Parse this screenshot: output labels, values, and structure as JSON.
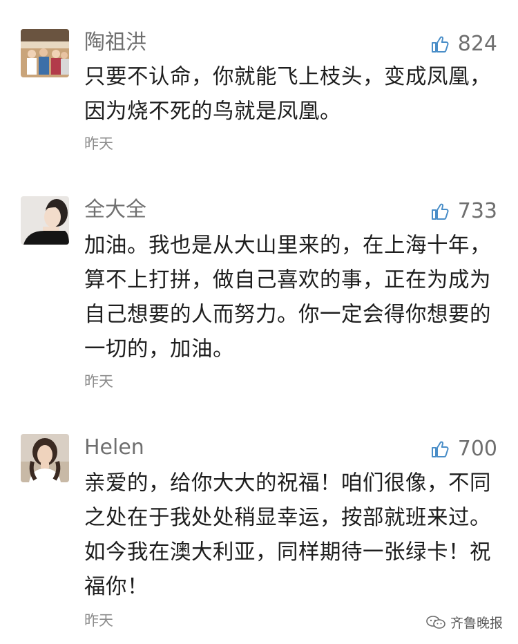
{
  "comments": [
    {
      "username": "陶祖洪",
      "likes": "824",
      "text": "只要不认命，你就能飞上枝头，变成凤凰，因为烧不死的鸟就是凤凰。",
      "time": "昨天",
      "avatar_icon": "avatar-group-photo"
    },
    {
      "username": "全大全",
      "likes": "733",
      "text": "加油。我也是从大山里来的，在上海十年，算不上打拼，做自己喜欢的事，正在为成为自己想要的人而努力。你一定会得你想要的一切的，加油。",
      "time": "昨天",
      "avatar_icon": "avatar-woman-portrait"
    },
    {
      "username": "Helen",
      "likes": "700",
      "text": "亲爱的，给你大大的祝福！咱们很像，不同之处在于我处处稍显幸运，按部就班来过。如今我在澳大利亚，同样期待一张绿卡！祝福你！",
      "time": "昨天",
      "avatar_icon": "avatar-woman-beach"
    }
  ],
  "watermark": {
    "text": "齐鲁晚报",
    "icon": "wechat-logo-icon"
  },
  "colors": {
    "username": "#6f6f6f",
    "content": "#1e1e1e",
    "time": "#8c8c8c",
    "like_icon": "#4a8ec8"
  }
}
